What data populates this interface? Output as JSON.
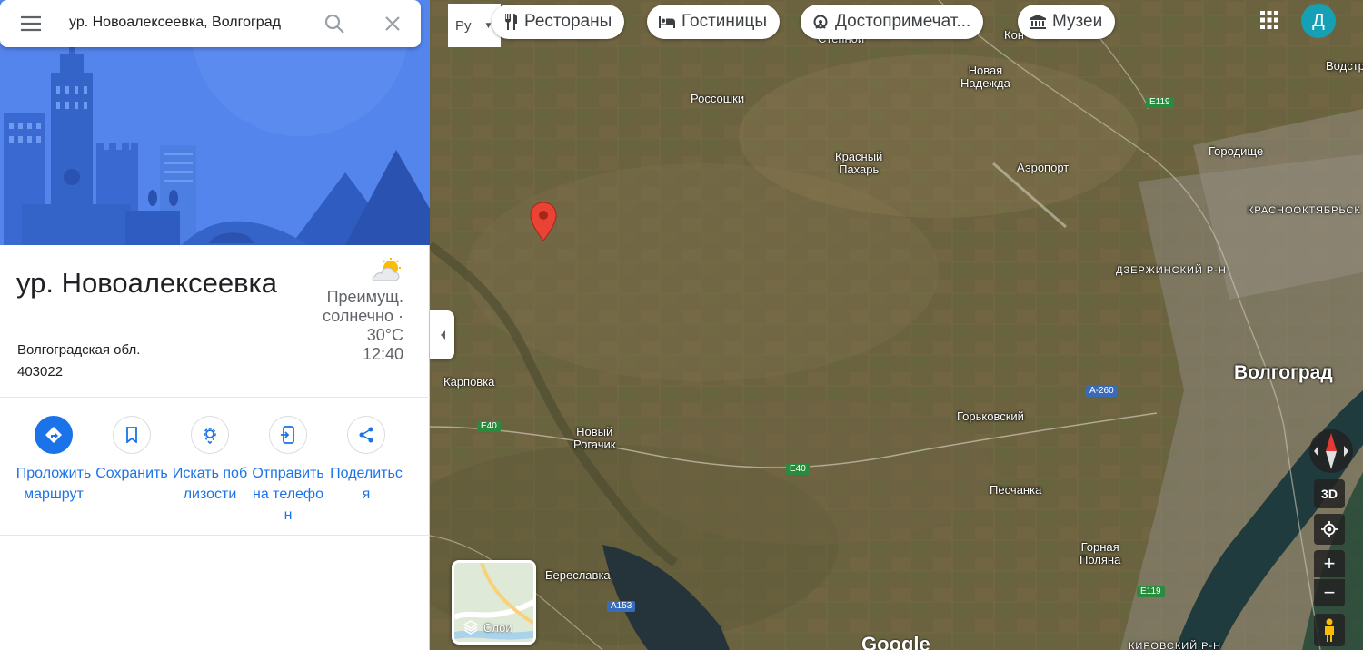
{
  "search": {
    "query": "ур. Новоалексеевка, Волгоград",
    "menu_icon": "hamburger-menu-icon",
    "search_icon": "search-icon",
    "close_icon": "close-icon"
  },
  "place": {
    "title": "ур. Новоалексеевка",
    "region": "Волгоградская обл.",
    "postal_code": "403022",
    "weather": {
      "condition": "Преимущ. солнечно ·",
      "temperature": "30°C",
      "time": "12:40",
      "icon": "partly-sunny-icon"
    }
  },
  "actions": [
    {
      "label": "Проложить маршрут",
      "icon": "directions-icon"
    },
    {
      "label": "Сохранить",
      "icon": "bookmark-icon"
    },
    {
      "label": "Искать поблизости",
      "icon": "nearby-icon"
    },
    {
      "label": "Отправить на телефон",
      "icon": "send-to-phone-icon"
    },
    {
      "label": "Поделиться",
      "icon": "share-icon"
    }
  ],
  "map": {
    "layer_select_label": "Ру",
    "chips": [
      {
        "label": "Рестораны",
        "icon": "restaurant-icon"
      },
      {
        "label": "Гостиницы",
        "icon": "hotel-icon"
      },
      {
        "label": "Достопримечат...",
        "icon": "attractions-icon"
      },
      {
        "label": "Музеи",
        "icon": "museum-icon"
      }
    ],
    "avatar_letter": "Д",
    "labels": {
      "stepnoy": "Степной",
      "kon": "Кон",
      "novaya_nadezhda_1": "Новая",
      "novaya_nadezhda_2": "Надежда",
      "vodstroy": "Водстр",
      "rossoshki": "Россошки",
      "krasny_pakhar_1": "Красный",
      "krasny_pakhar_2": "Пахарь",
      "aeroport": "Аэропорт",
      "gorodishche": "Городище",
      "krasnooktyabrsky": "КРАСНООКТЯБРЬСК",
      "dzerzhinsky": "ДЗЕРЖИНСКИЙ Р-Н",
      "karpovka": "Карповка",
      "volgograd": "Волгоград",
      "gorkovsky": "Горьковский",
      "novy_rogachik_1": "Новый",
      "novy_rogachik_2": "Рогачик",
      "peschanka": "Песчанка",
      "bereslavka": "Береславка",
      "gornaya_polyana_1": "Горная",
      "gornaya_polyana_2": "Поляна",
      "kirovsky": "КИРОВСКИЙ Р-Н"
    },
    "roads": {
      "e119_top": "E119",
      "e119_bottom": "E119",
      "a260": "A-260",
      "e40_left": "E40",
      "e40_mid": "E40",
      "a153": "A153"
    },
    "layers_label": "Слои",
    "logo": "Google",
    "controls": {
      "btn_3d": "3D",
      "zoom_in": "+",
      "zoom_out": "−"
    }
  }
}
